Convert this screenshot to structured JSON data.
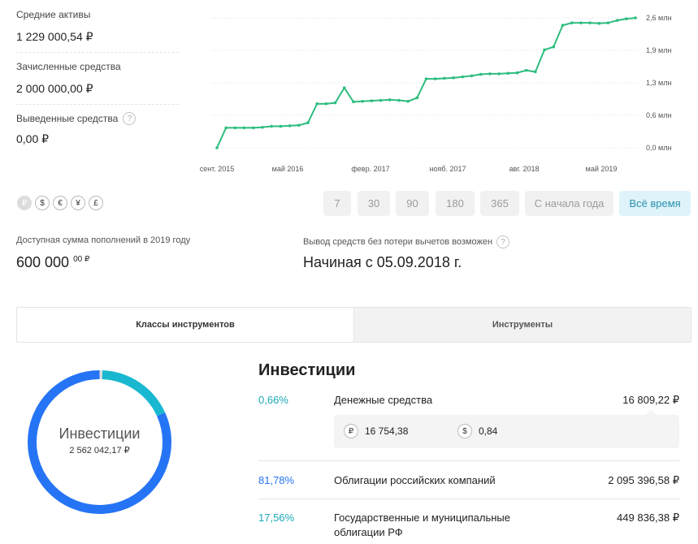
{
  "stats": {
    "avg_assets": {
      "label": "Средние активы",
      "value": "1 229 000,54 ₽"
    },
    "deposited": {
      "label": "Зачисленные средства",
      "value": "2 000 000,00 ₽"
    },
    "withdrawn": {
      "label": "Выведенные средства",
      "value": "0,00 ₽",
      "help": "?"
    }
  },
  "chart_data": {
    "type": "line",
    "x_labels": [
      "сент. 2015",
      "май 2016",
      "февр. 2017",
      "нояб. 2017",
      "авг. 2018",
      "май 2019"
    ],
    "y_labels": [
      "2,6 млн",
      "1,9 млн",
      "1,3 млн",
      "0,6 млн",
      "0,0 млн"
    ],
    "ylim_mln": [
      0,
      2.6
    ],
    "grid": true,
    "color": "#2dbd7d",
    "series": [
      {
        "values_mln": [
          0.0,
          0.4,
          0.4,
          0.4,
          0.4,
          0.41,
          0.43,
          0.43,
          0.44,
          0.45,
          0.5,
          0.88,
          0.88,
          0.9,
          1.2,
          0.92,
          0.93,
          0.94,
          0.95,
          0.96,
          0.95,
          0.93,
          1.0,
          1.38,
          1.38,
          1.39,
          1.4,
          1.42,
          1.44,
          1.47,
          1.48,
          1.48,
          1.49,
          1.5,
          1.55,
          1.52,
          1.96,
          2.02,
          2.45,
          2.5,
          2.5,
          2.5,
          2.49,
          2.5,
          2.55,
          2.58,
          2.6
        ]
      }
    ]
  },
  "currencies": [
    {
      "symbol": "₽",
      "active": true
    },
    {
      "symbol": "$",
      "active": false
    },
    {
      "symbol": "€",
      "active": false
    },
    {
      "symbol": "¥",
      "active": false
    },
    {
      "symbol": "£",
      "active": false
    }
  ],
  "periods": [
    "7",
    "30",
    "90",
    "180",
    "365",
    "С начала года",
    "Всё время"
  ],
  "active_period": "Всё время",
  "info": {
    "available_label": "Доступная сумма пополнений в 2019 году",
    "available_main": "600 000",
    "available_cents": "00 ₽",
    "withdraw_label": "Вывод средств без потери вычетов возможен",
    "withdraw_value": "Начиная с 05.09.2018 г."
  },
  "tabs": [
    "Классы инструментов",
    "Инструменты"
  ],
  "donut": {
    "title": "Инвестиции",
    "value": "2 562 042,17 ₽",
    "segments": [
      {
        "pct": 0.66,
        "color": "#dddddd"
      },
      {
        "pct": 17.56,
        "color": "#19b8d0"
      },
      {
        "pct": 81.78,
        "color": "#2574f5"
      }
    ]
  },
  "investments": {
    "title": "Инвестиции",
    "rows": [
      {
        "pct": "0,66%",
        "name": "Денежные средства",
        "amount": "16 809,22 ₽",
        "color": "#19a8b8"
      },
      {
        "pct": "81,78%",
        "name": "Облигации российских компаний",
        "amount": "2 095 396,58 ₽",
        "color": "#2574f5"
      },
      {
        "pct": "17,56%",
        "name": "Государственные и муниципальные облигации РФ",
        "amount": "449 836,38 ₽",
        "color": "#19a8b8"
      }
    ],
    "cash_breakdown": [
      {
        "symbol": "₽",
        "value": "16 754,38"
      },
      {
        "symbol": "$",
        "value": "0,84"
      }
    ]
  }
}
